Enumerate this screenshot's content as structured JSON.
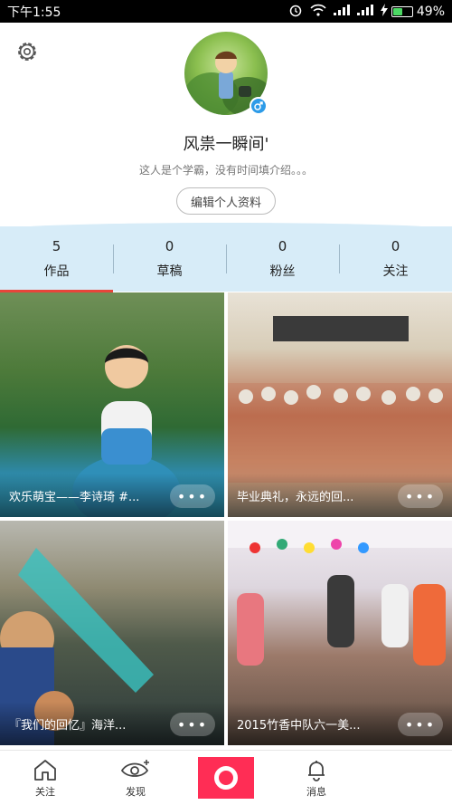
{
  "status_bar": {
    "time": "下午1:55",
    "battery_text": "49%",
    "battery_level": 0.49,
    "icons": [
      "alarm-icon",
      "wifi-icon",
      "signal-icon",
      "signal-icon",
      "charging-icon",
      "battery-icon"
    ]
  },
  "profile": {
    "username": "风祟一瞬间'",
    "bio": "这人是个学霸，没有时间填介绍。。。",
    "edit_label": "编辑个人资料",
    "gender_symbol": "♂"
  },
  "stats": [
    {
      "count": "5",
      "label": "作品"
    },
    {
      "count": "0",
      "label": "草稿"
    },
    {
      "count": "0",
      "label": "粉丝"
    },
    {
      "count": "0",
      "label": "关注"
    }
  ],
  "tiles": [
    {
      "caption": "欢乐萌宝——李诗琦 #...",
      "more_label": "•••"
    },
    {
      "caption": "毕业典礼，永远的回...",
      "more_label": "•••"
    },
    {
      "caption": "『我们的回忆』海洋...",
      "more_label": "•••"
    },
    {
      "caption": "2015竹香中队六一美...",
      "more_label": "•••"
    }
  ],
  "bottom_nav": {
    "home_label": "关注",
    "discover_label": "发现",
    "messages_label": "消息"
  },
  "colors": {
    "accent": "#ff2d55",
    "stats_bg": "#d7ecf8",
    "indicator": "#e8443a",
    "gender_badge": "#2d9be8"
  }
}
